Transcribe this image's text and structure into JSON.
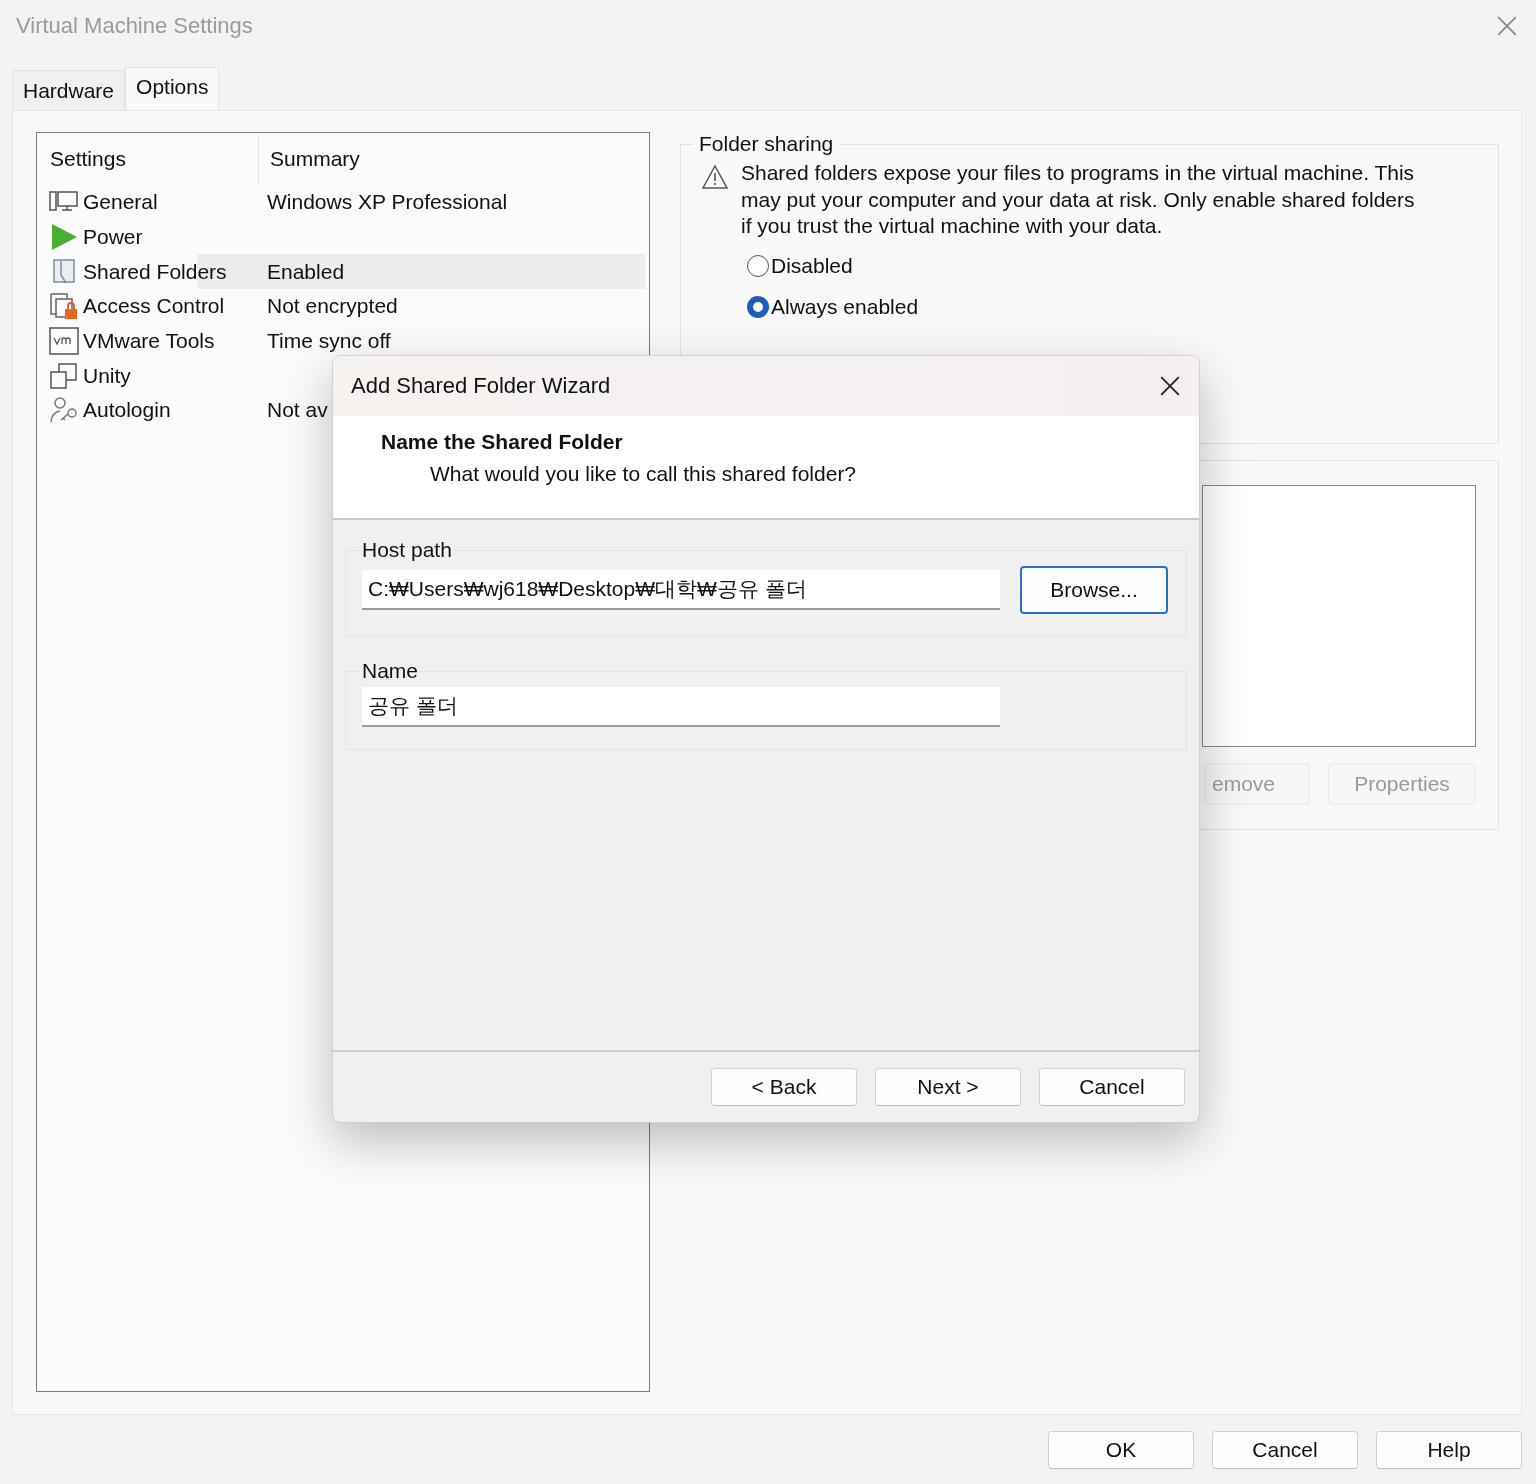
{
  "window": {
    "title": "Virtual Machine Settings"
  },
  "tabs": [
    {
      "label": "Hardware",
      "selected": false
    },
    {
      "label": "Options",
      "selected": true
    }
  ],
  "settings_list": {
    "columns": [
      "Settings",
      "Summary"
    ],
    "rows": [
      {
        "kind": "general",
        "setting": "General",
        "summary": "Windows XP Professional",
        "selected": false
      },
      {
        "kind": "power",
        "setting": "Power",
        "selected": false
      },
      {
        "kind": "shared",
        "setting": "Shared Folders",
        "summary": "Enabled",
        "selected": true
      },
      {
        "kind": "access",
        "setting": "Access Control",
        "summary": "Not encrypted",
        "selected": false
      },
      {
        "kind": "tools",
        "setting": "VMware Tools",
        "summary": "Time sync off",
        "selected": false
      },
      {
        "kind": "unity",
        "setting": "Unity",
        "selected": false
      },
      {
        "kind": "autologin",
        "setting": "Autologin",
        "summary": "Not av",
        "selected": false
      }
    ]
  },
  "folder_sharing": {
    "title": "Folder sharing",
    "warning": "Shared folders expose your files to programs in the virtual machine. This may put your computer and your data at risk. Only enable shared folders if you trust the virtual machine with your data.",
    "options": [
      {
        "label": "Disabled",
        "selected": false
      },
      {
        "label": "Always enabled",
        "selected": true
      }
    ]
  },
  "folders": {
    "buttons": [
      {
        "label": "emove",
        "disabled": true
      },
      {
        "label": "Properties",
        "disabled": true
      }
    ]
  },
  "wizard": {
    "title": "Add Shared Folder Wizard",
    "heading": "Name the Shared Folder",
    "subtitle": "What would you like to call this shared folder?",
    "fields": [
      {
        "label": "Host path",
        "value": "C:₩Users₩wj618₩Desktop₩대학₩공유 폴더",
        "button": {
          "label": "Browse...",
          "focused": true
        }
      },
      {
        "label": "Name",
        "value": "공유 폴더"
      }
    ],
    "buttons": [
      "< Back",
      "Next >",
      "Cancel"
    ]
  },
  "buttons": [
    "OK",
    "Cancel",
    "Help"
  ]
}
